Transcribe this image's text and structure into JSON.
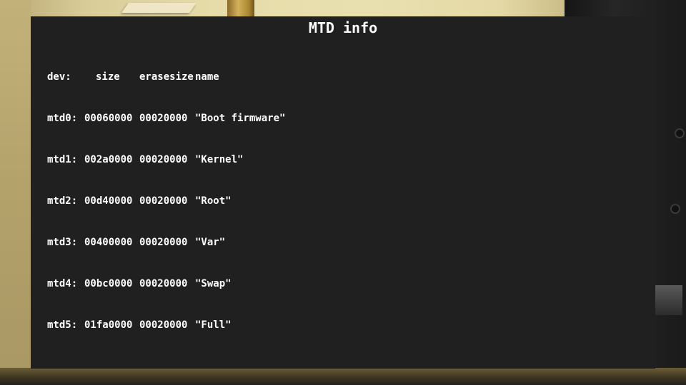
{
  "title": "MTD info",
  "table": {
    "headers": {
      "dev": "dev:",
      "size": "size",
      "erasesize": "erasesize",
      "name": "name"
    },
    "rows": [
      {
        "dev": "mtd0:",
        "size": "00060000",
        "erasesize": "00020000",
        "name": "\"Boot firmware\""
      },
      {
        "dev": "mtd1:",
        "size": "002a0000",
        "erasesize": "00020000",
        "name": "\"Kernel\""
      },
      {
        "dev": "mtd2:",
        "size": "00d40000",
        "erasesize": "00020000",
        "name": "\"Root\""
      },
      {
        "dev": "mtd3:",
        "size": "00400000",
        "erasesize": "00020000",
        "name": "\"Var\""
      },
      {
        "dev": "mtd4:",
        "size": "00bc0000",
        "erasesize": "00020000",
        "name": "\"Swap\""
      },
      {
        "dev": "mtd5:",
        "size": "01fa0000",
        "erasesize": "00020000",
        "name": "\"Full\""
      }
    ]
  },
  "colors": {
    "panel_background": "#202020",
    "text": "#ffffff"
  }
}
